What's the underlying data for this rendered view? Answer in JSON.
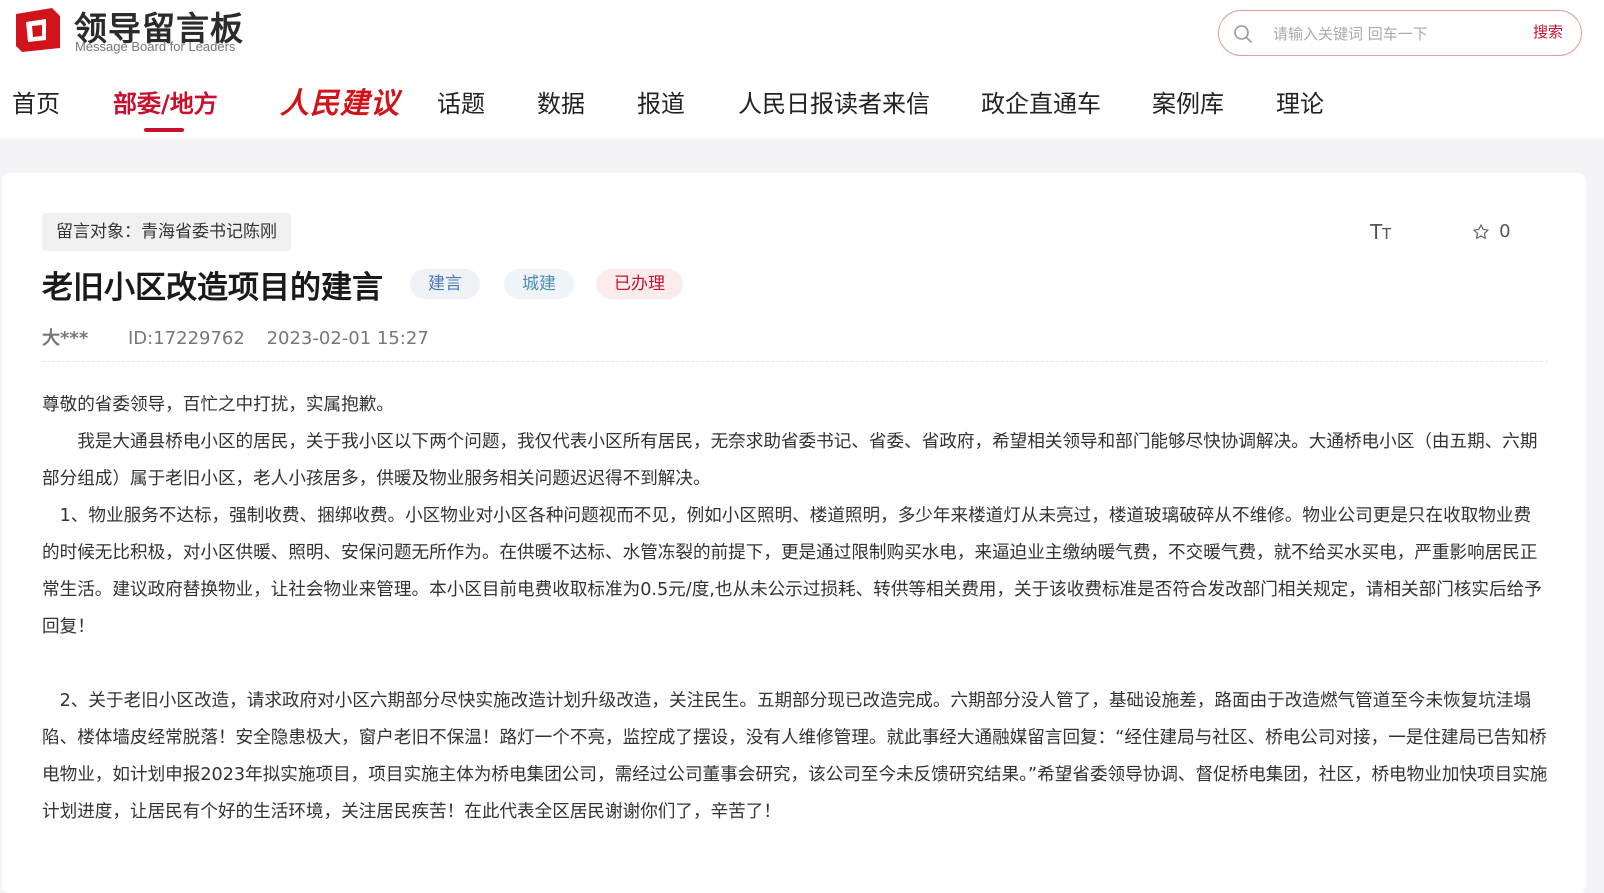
{
  "site": {
    "name": "领导留言板",
    "subtitle": "Message Board for Leaders",
    "brand_color": "#c8102e"
  },
  "search": {
    "placeholder": "请输入关键词 回车一下",
    "button_label": "搜索",
    "icon": "search-icon"
  },
  "nav": {
    "items": [
      {
        "label": "首页",
        "active": false
      },
      {
        "label": "部委/地方",
        "active": true
      },
      {
        "label": "人民建议",
        "active": false,
        "style": "logo-script"
      },
      {
        "label": "话题",
        "active": false
      },
      {
        "label": "数据",
        "active": false
      },
      {
        "label": "报道",
        "active": false
      },
      {
        "label": "人民日报读者来信",
        "active": false
      },
      {
        "label": "政企直通车",
        "active": false
      },
      {
        "label": "案例库",
        "active": false
      },
      {
        "label": "理论",
        "active": false
      }
    ]
  },
  "message": {
    "recipient": "留言对象：青海省委书记陈刚",
    "title": "老旧小区改造项目的建言",
    "tags": [
      {
        "label": "建言",
        "color": "#4a78b5",
        "bg": "#eef2f7"
      },
      {
        "label": "城建",
        "color": "#4a8fb5",
        "bg": "#eef4f7"
      },
      {
        "label": "已办理",
        "color": "#c8102e",
        "bg": "#fbecec"
      }
    ],
    "author": "大***",
    "id": "ID:17229762",
    "datetime": "2023-02-01 15:27",
    "favorites": "0",
    "paragraphs": [
      "尊敬的省委领导，百忙之中打扰，实属抱歉。",
      "　　我是大通县桥电小区的居民，关于我小区以下两个问题，我仅代表小区所有居民，无奈求助省委书记、省委、省政府，希望相关领导和部门能够尽快协调解决。大通桥电小区（由五期、六期部分组成）属于老旧小区，老人小孩居多，供暖及物业服务相关问题迟迟得不到解决。",
      "　1、物业服务不达标，强制收费、捆绑收费。小区物业对小区各种问题视而不见，例如小区照明、楼道照明，多少年来楼道灯从未亮过，楼道玻璃破碎从不维修。物业公司更是只在收取物业费的时候无比积极，对小区供暖、照明、安保问题无所作为。在供暖不达标、水管冻裂的前提下，更是通过限制购买水电，来逼迫业主缴纳暖气费，不交暖气费，就不给买水买电，严重影响居民正常生活。建议政府替换物业，让社会物业来管理。本小区目前电费收取标准为0.5元/度,也从未公示过损耗、转供等相关费用，关于该收费标准是否符合发改部门相关规定，请相关部门核实后给予回复！",
      "",
      "　2、关于老旧小区改造，请求政府对小区六期部分尽快实施改造计划升级改造，关注民生。五期部分现已改造完成。六期部分没人管了，基础设施差，路面由于改造燃气管道至今未恢复坑洼塌陷、楼体墙皮经常脱落！安全隐患极大，窗户老旧不保温！路灯一个不亮，监控成了摆设，没有人维修管理。就此事经大通融媒留言回复：“经住建局与社区、桥电公司对接，一是住建局已告知桥电物业，如计划申报2023年拟实施项目，项目实施主体为桥电集团公司，需经过公司董事会研究，该公司至今未反馈研究结果。”希望省委领导协调、督促桥电集团，社区，桥电物业加快项目实施计划进度，让居民有个好的生活环境，关注居民疾苦！在此代表全区居民谢谢你们了，辛苦了！"
    ]
  }
}
